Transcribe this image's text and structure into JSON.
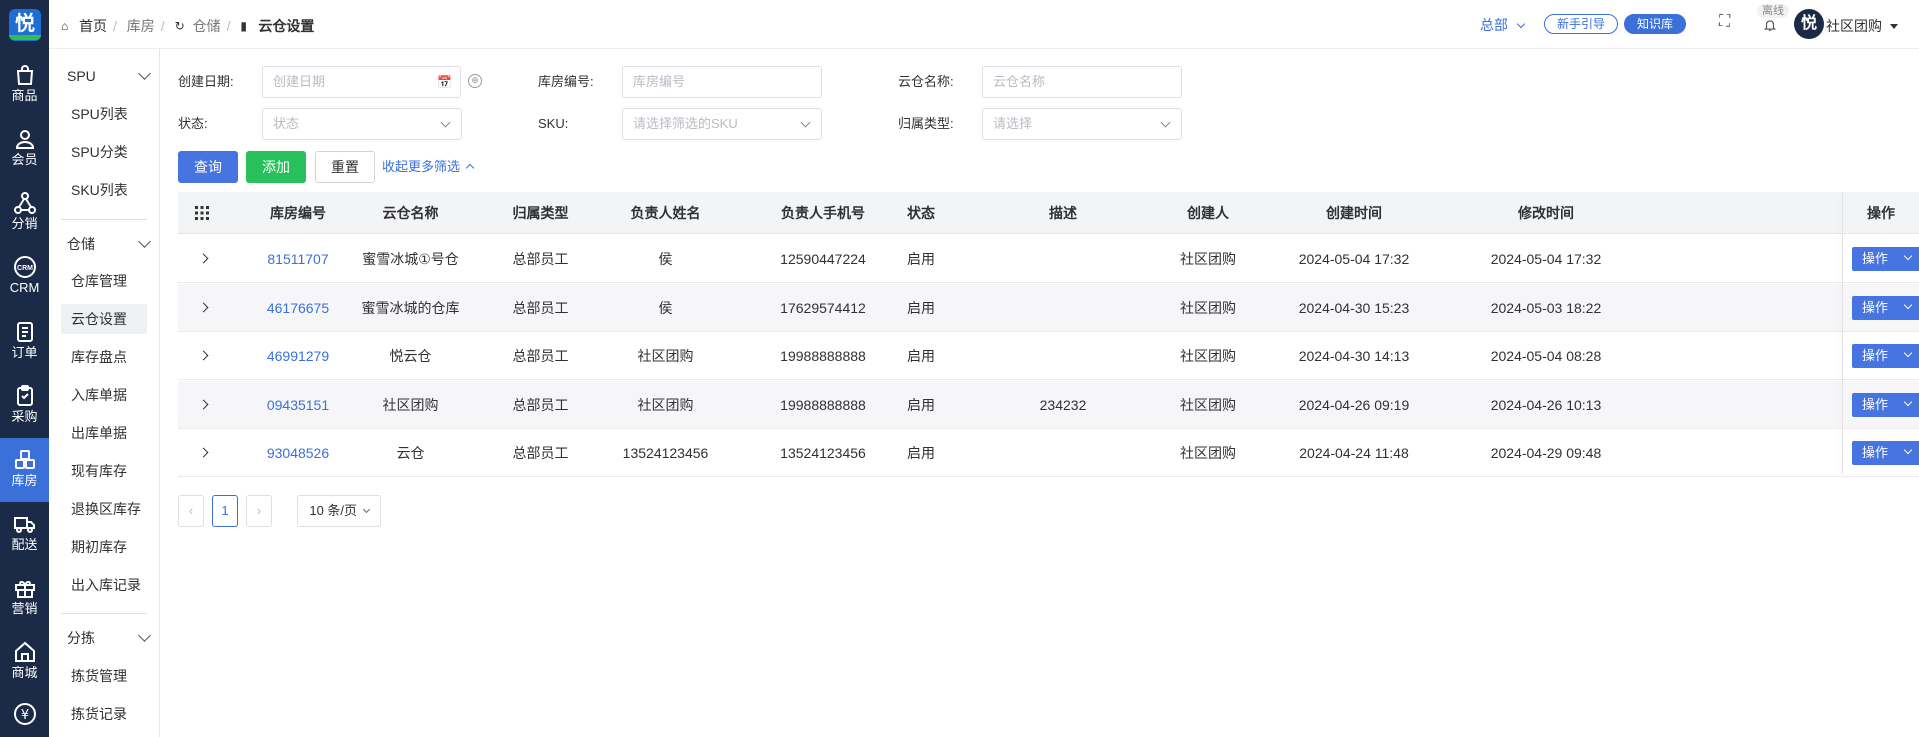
{
  "rail": {
    "logo": "悦",
    "items": [
      {
        "label": "商品",
        "icon": "bag-icon"
      },
      {
        "label": "会员",
        "icon": "user-icon"
      },
      {
        "label": "分销",
        "icon": "share-network-icon"
      },
      {
        "label": "CRM",
        "icon": "crm-icon"
      },
      {
        "label": "订单",
        "icon": "document-icon"
      },
      {
        "label": "采购",
        "icon": "clipboard-icon"
      },
      {
        "label": "库房",
        "icon": "grid-blocks-icon"
      },
      {
        "label": "配送",
        "icon": "truck-icon"
      },
      {
        "label": "营销",
        "icon": "gift-icon"
      },
      {
        "label": "商城",
        "icon": "house-icon"
      },
      {
        "label": "¥",
        "icon": "yen-icon"
      }
    ]
  },
  "submenu": {
    "group_spu": "SPU",
    "spu_items": [
      "SPU列表",
      "SPU分类",
      "SKU列表"
    ],
    "group_store": "仓储",
    "store_items": [
      "仓库管理",
      "云仓设置",
      "库存盘点",
      "入库单据",
      "出库单据",
      "现有库存",
      "退换区库存",
      "期初库存",
      "出入库记录"
    ],
    "group_sort": "分拣",
    "sort_items": [
      "拣货管理",
      "拣货记录"
    ]
  },
  "header": {
    "breadcrumb": [
      "首页",
      "库房",
      "仓储",
      "云仓设置"
    ],
    "org": "总部",
    "guide": "新手引导",
    "kb": "知识库",
    "offline": "离线",
    "user": "社区团购",
    "avatar_text": "悦"
  },
  "filters": {
    "date_label": "创建日期:",
    "date_placeholder": "创建日期",
    "store_no_label": "库房编号:",
    "store_no_placeholder": "库房编号",
    "cloud_name_label": "云仓名称:",
    "cloud_name_placeholder": "云仓名称",
    "status_label": "状态:",
    "status_placeholder": "状态",
    "sku_label": "SKU:",
    "sku_placeholder": "请选择筛选的SKU",
    "type_label": "归属类型:",
    "type_placeholder": "请选择",
    "query": "查询",
    "add": "添加",
    "reset": "重置",
    "collapse": "收起更多筛选"
  },
  "table": {
    "columns": [
      "库房编号",
      "云仓名称",
      "归属类型",
      "负责人姓名",
      "负责人手机号",
      "状态",
      "描述",
      "创建人",
      "创建时间",
      "修改时间",
      "操作"
    ],
    "rows": [
      [
        "81511707",
        "蜜雪冰城①号仓",
        "总部员工",
        "侯",
        "12590447224",
        "启用",
        "",
        "社区团购",
        "2024-05-04 17:32",
        "2024-05-04 17:32"
      ],
      [
        "46176675",
        "蜜雪冰城的仓库",
        "总部员工",
        "侯",
        "17629574412",
        "启用",
        "",
        "社区团购",
        "2024-04-30 15:23",
        "2024-05-03 18:22"
      ],
      [
        "46991279",
        "悦云仓",
        "总部员工",
        "社区团购",
        "19988888888",
        "启用",
        "",
        "社区团购",
        "2024-04-30 14:13",
        "2024-05-04 08:28"
      ],
      [
        "09435151",
        "社区团购",
        "总部员工",
        "社区团购",
        "19988888888",
        "启用",
        "234232",
        "社区团购",
        "2024-04-26 09:19",
        "2024-04-26 10:13"
      ],
      [
        "93048526",
        "云仓",
        "总部员工",
        "13524123456",
        "13524123456",
        "启用",
        "",
        "社区团购",
        "2024-04-24 11:48",
        "2024-04-29 09:48"
      ]
    ],
    "op_label": "操作"
  },
  "pagination": {
    "current": "1",
    "page_size": "10 条/页"
  },
  "colors": {
    "rail_bg": "#1b2a47",
    "accent": "#3b70d8",
    "add_green": "#27c05a",
    "annotation_red": "#e53935"
  }
}
